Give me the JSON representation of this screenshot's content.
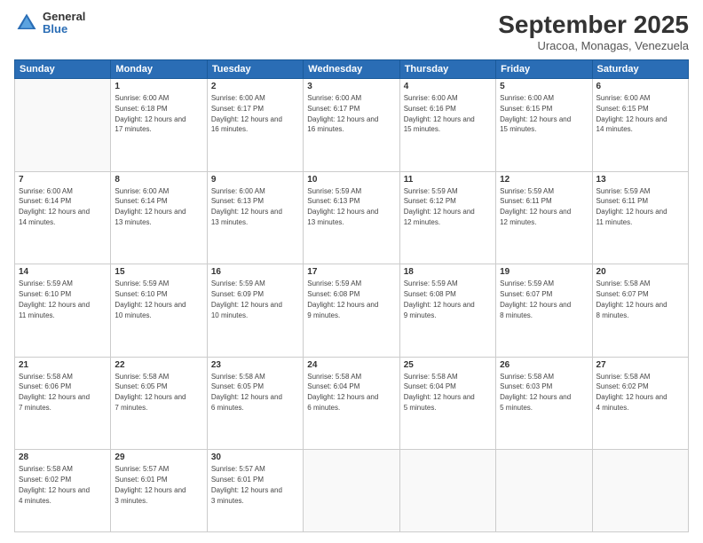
{
  "header": {
    "logo": {
      "general": "General",
      "blue": "Blue"
    },
    "month": "September 2025",
    "location": "Uracoa, Monagas, Venezuela"
  },
  "weekdays": [
    "Sunday",
    "Monday",
    "Tuesday",
    "Wednesday",
    "Thursday",
    "Friday",
    "Saturday"
  ],
  "weeks": [
    [
      {
        "day": null
      },
      {
        "day": 1,
        "sunrise": "Sunrise: 6:00 AM",
        "sunset": "Sunset: 6:18 PM",
        "daylight": "Daylight: 12 hours and 17 minutes."
      },
      {
        "day": 2,
        "sunrise": "Sunrise: 6:00 AM",
        "sunset": "Sunset: 6:17 PM",
        "daylight": "Daylight: 12 hours and 16 minutes."
      },
      {
        "day": 3,
        "sunrise": "Sunrise: 6:00 AM",
        "sunset": "Sunset: 6:17 PM",
        "daylight": "Daylight: 12 hours and 16 minutes."
      },
      {
        "day": 4,
        "sunrise": "Sunrise: 6:00 AM",
        "sunset": "Sunset: 6:16 PM",
        "daylight": "Daylight: 12 hours and 15 minutes."
      },
      {
        "day": 5,
        "sunrise": "Sunrise: 6:00 AM",
        "sunset": "Sunset: 6:15 PM",
        "daylight": "Daylight: 12 hours and 15 minutes."
      },
      {
        "day": 6,
        "sunrise": "Sunrise: 6:00 AM",
        "sunset": "Sunset: 6:15 PM",
        "daylight": "Daylight: 12 hours and 14 minutes."
      }
    ],
    [
      {
        "day": 7,
        "sunrise": "Sunrise: 6:00 AM",
        "sunset": "Sunset: 6:14 PM",
        "daylight": "Daylight: 12 hours and 14 minutes."
      },
      {
        "day": 8,
        "sunrise": "Sunrise: 6:00 AM",
        "sunset": "Sunset: 6:14 PM",
        "daylight": "Daylight: 12 hours and 13 minutes."
      },
      {
        "day": 9,
        "sunrise": "Sunrise: 6:00 AM",
        "sunset": "Sunset: 6:13 PM",
        "daylight": "Daylight: 12 hours and 13 minutes."
      },
      {
        "day": 10,
        "sunrise": "Sunrise: 5:59 AM",
        "sunset": "Sunset: 6:13 PM",
        "daylight": "Daylight: 12 hours and 13 minutes."
      },
      {
        "day": 11,
        "sunrise": "Sunrise: 5:59 AM",
        "sunset": "Sunset: 6:12 PM",
        "daylight": "Daylight: 12 hours and 12 minutes."
      },
      {
        "day": 12,
        "sunrise": "Sunrise: 5:59 AM",
        "sunset": "Sunset: 6:11 PM",
        "daylight": "Daylight: 12 hours and 12 minutes."
      },
      {
        "day": 13,
        "sunrise": "Sunrise: 5:59 AM",
        "sunset": "Sunset: 6:11 PM",
        "daylight": "Daylight: 12 hours and 11 minutes."
      }
    ],
    [
      {
        "day": 14,
        "sunrise": "Sunrise: 5:59 AM",
        "sunset": "Sunset: 6:10 PM",
        "daylight": "Daylight: 12 hours and 11 minutes."
      },
      {
        "day": 15,
        "sunrise": "Sunrise: 5:59 AM",
        "sunset": "Sunset: 6:10 PM",
        "daylight": "Daylight: 12 hours and 10 minutes."
      },
      {
        "day": 16,
        "sunrise": "Sunrise: 5:59 AM",
        "sunset": "Sunset: 6:09 PM",
        "daylight": "Daylight: 12 hours and 10 minutes."
      },
      {
        "day": 17,
        "sunrise": "Sunrise: 5:59 AM",
        "sunset": "Sunset: 6:08 PM",
        "daylight": "Daylight: 12 hours and 9 minutes."
      },
      {
        "day": 18,
        "sunrise": "Sunrise: 5:59 AM",
        "sunset": "Sunset: 6:08 PM",
        "daylight": "Daylight: 12 hours and 9 minutes."
      },
      {
        "day": 19,
        "sunrise": "Sunrise: 5:59 AM",
        "sunset": "Sunset: 6:07 PM",
        "daylight": "Daylight: 12 hours and 8 minutes."
      },
      {
        "day": 20,
        "sunrise": "Sunrise: 5:58 AM",
        "sunset": "Sunset: 6:07 PM",
        "daylight": "Daylight: 12 hours and 8 minutes."
      }
    ],
    [
      {
        "day": 21,
        "sunrise": "Sunrise: 5:58 AM",
        "sunset": "Sunset: 6:06 PM",
        "daylight": "Daylight: 12 hours and 7 minutes."
      },
      {
        "day": 22,
        "sunrise": "Sunrise: 5:58 AM",
        "sunset": "Sunset: 6:05 PM",
        "daylight": "Daylight: 12 hours and 7 minutes."
      },
      {
        "day": 23,
        "sunrise": "Sunrise: 5:58 AM",
        "sunset": "Sunset: 6:05 PM",
        "daylight": "Daylight: 12 hours and 6 minutes."
      },
      {
        "day": 24,
        "sunrise": "Sunrise: 5:58 AM",
        "sunset": "Sunset: 6:04 PM",
        "daylight": "Daylight: 12 hours and 6 minutes."
      },
      {
        "day": 25,
        "sunrise": "Sunrise: 5:58 AM",
        "sunset": "Sunset: 6:04 PM",
        "daylight": "Daylight: 12 hours and 5 minutes."
      },
      {
        "day": 26,
        "sunrise": "Sunrise: 5:58 AM",
        "sunset": "Sunset: 6:03 PM",
        "daylight": "Daylight: 12 hours and 5 minutes."
      },
      {
        "day": 27,
        "sunrise": "Sunrise: 5:58 AM",
        "sunset": "Sunset: 6:02 PM",
        "daylight": "Daylight: 12 hours and 4 minutes."
      }
    ],
    [
      {
        "day": 28,
        "sunrise": "Sunrise: 5:58 AM",
        "sunset": "Sunset: 6:02 PM",
        "daylight": "Daylight: 12 hours and 4 minutes."
      },
      {
        "day": 29,
        "sunrise": "Sunrise: 5:57 AM",
        "sunset": "Sunset: 6:01 PM",
        "daylight": "Daylight: 12 hours and 3 minutes."
      },
      {
        "day": 30,
        "sunrise": "Sunrise: 5:57 AM",
        "sunset": "Sunset: 6:01 PM",
        "daylight": "Daylight: 12 hours and 3 minutes."
      },
      {
        "day": null
      },
      {
        "day": null
      },
      {
        "day": null
      },
      {
        "day": null
      }
    ]
  ]
}
